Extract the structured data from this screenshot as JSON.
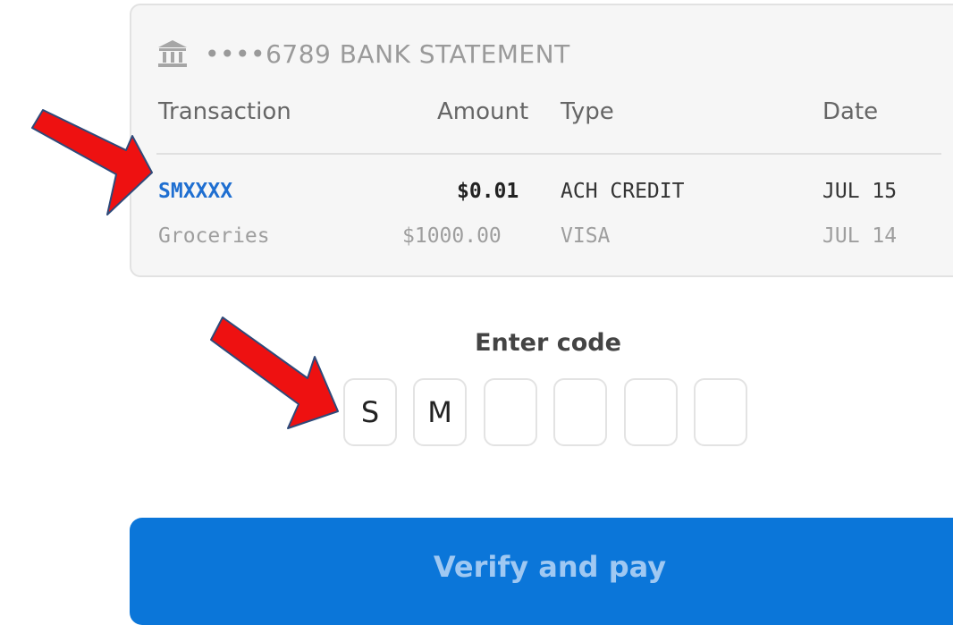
{
  "statement": {
    "title": "••••6789 BANK STATEMENT",
    "icon": "bank-icon",
    "columns": [
      "Transaction",
      "Amount",
      "Type",
      "Date"
    ],
    "rows": [
      {
        "transaction": "SMXXXX",
        "amount": "$0.01",
        "type": "ACH CREDIT",
        "date": "JUL 15"
      },
      {
        "transaction": "Groceries",
        "amount": "$1000.00",
        "type": "VISA",
        "date": "JUL 14"
      }
    ]
  },
  "code": {
    "label": "Enter code",
    "digits": [
      "S",
      "M",
      "",
      "",
      "",
      ""
    ]
  },
  "verify_button": {
    "label": "Verify and pay"
  },
  "colors": {
    "accent": "#0b76d9",
    "link": "#1f6fd1",
    "arrow": "#ee1111"
  }
}
